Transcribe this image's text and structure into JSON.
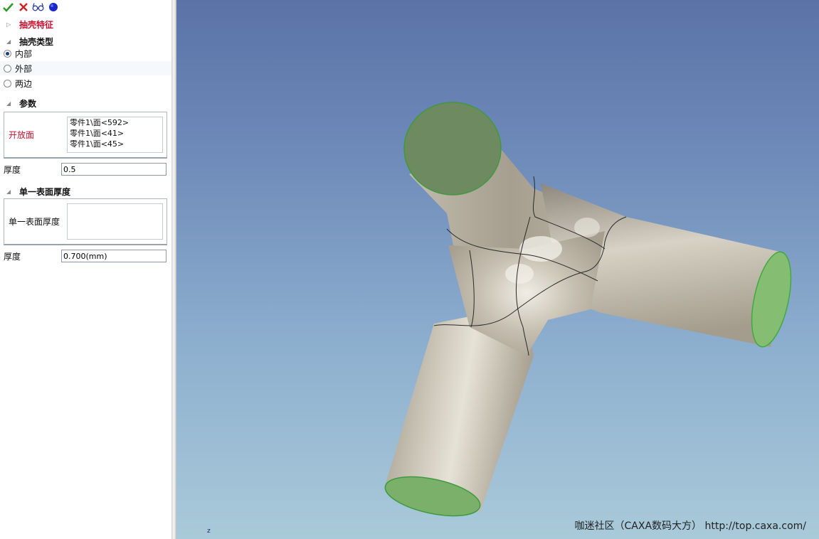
{
  "toolbar": {
    "items": [
      {
        "name": "ok-icon",
        "color": "#2a9d2a"
      },
      {
        "name": "cancel-icon",
        "color": "#d42020"
      },
      {
        "name": "preview-glasses-icon",
        "color": "#2a3fa0"
      },
      {
        "name": "apply-dot-icon",
        "color": "#1a26c8"
      }
    ]
  },
  "panel": {
    "feature_section": "抽壳特征",
    "type_section": "抽壳类型",
    "shell_types": [
      {
        "label": "内部",
        "selected": true
      },
      {
        "label": "外部",
        "selected": false
      },
      {
        "label": "两边",
        "selected": false
      }
    ],
    "params_section": "参数",
    "open_faces_label": "开放面",
    "open_faces": [
      "零件1\\面<592>",
      "零件1\\面<41>",
      "零件1\\面<45>"
    ],
    "thickness_label": "厚度",
    "thickness_value": "0.5",
    "single_section": "单一表面厚度",
    "single_faces_label": "单一表面厚度",
    "single_thickness_label": "厚度",
    "single_thickness_value": "0.700(mm)"
  },
  "viewport": {
    "axis_label": "z",
    "watermark": "咖迷社区（CAXA数码大方） http://top.caxa.com/",
    "face_highlight_color": "#7fb86a",
    "body_color": "#b8b0a2"
  }
}
